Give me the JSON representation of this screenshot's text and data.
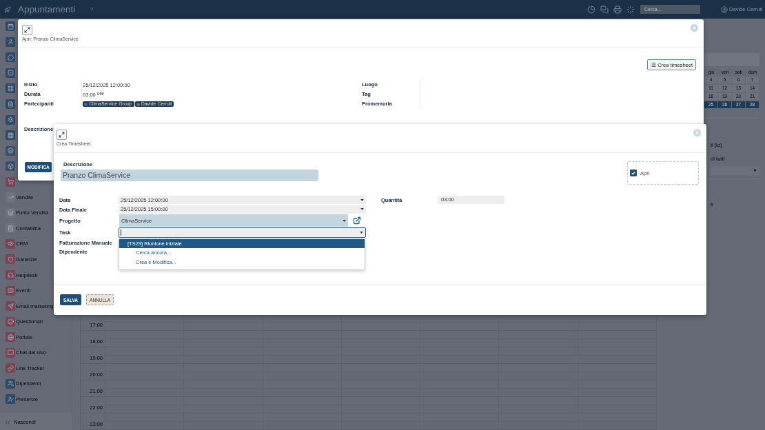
{
  "navbar": {
    "title": "Appuntamenti",
    "help": "?",
    "search": {
      "placeholder": "Cerca..."
    },
    "user": "Davide Cerruti"
  },
  "sidebar": {
    "items": [
      {
        "color": "#2e4a67"
      },
      {
        "color": "#2e4a67"
      },
      {
        "color": "#2e4a67"
      },
      {
        "color": "#2e4a67"
      },
      {
        "color": "#2e4a67"
      },
      {
        "color": "#2e4a67"
      },
      {
        "color": "#2e4a67"
      },
      {
        "color": "#2e4a67"
      },
      {
        "color": "#3a5068"
      },
      {
        "color": "#3a5068"
      },
      {
        "color": "#7a4552"
      },
      {
        "label": "Vendite",
        "color": "#6e727c"
      },
      {
        "label": "Punto Vendita",
        "color": "#6e727c"
      },
      {
        "label": "Contabilità",
        "color": "#6e727c"
      },
      {
        "label": "CRM",
        "color": "#7a4552"
      },
      {
        "label": "Garanzie",
        "color": "#7a4552"
      },
      {
        "label": "Helpdesk",
        "color": "#7a4552"
      },
      {
        "label": "Eventi",
        "color": "#7a4552"
      },
      {
        "label": "Email marketing",
        "color": "#7a4552"
      },
      {
        "label": "Questionari",
        "color": "#7a4552"
      },
      {
        "label": "Portale",
        "color": "#7a4552"
      },
      {
        "label": "Chat dal vivo",
        "color": "#7a4552"
      },
      {
        "label": "Link Tracker",
        "color": "#7a4552"
      },
      {
        "label": "Dipendenti",
        "color": "#2e4a67"
      },
      {
        "label": "Presenze",
        "color": "#2e4a67"
      }
    ],
    "collapse_label": "Nascondi"
  },
  "calendar": {
    "hours": [
      "17:00",
      "18:00",
      "19:00",
      "20:00",
      "21:00",
      "22:00",
      "23:00"
    ]
  },
  "side_panel": {
    "weekdays": [
      "gio",
      "ven",
      "sab",
      "dom"
    ],
    "weeks": [
      {
        "days": [
          {
            "day": "4",
            "selected": false
          },
          {
            "day": "5",
            "selected": false
          },
          {
            "day": "6",
            "selected": false
          },
          {
            "day": "7",
            "selected": false
          }
        ]
      },
      {
        "days": [
          {
            "day": "11",
            "selected": false
          },
          {
            "day": "12",
            "selected": false
          },
          {
            "day": "13",
            "selected": false
          },
          {
            "day": "14",
            "selected": false
          }
        ]
      },
      {
        "days": [
          {
            "day": "18",
            "selected": false
          },
          {
            "day": "19",
            "selected": false
          },
          {
            "day": "20",
            "selected": false
          },
          {
            "day": "21",
            "selected": false
          }
        ]
      },
      {
        "days": [
          {
            "day": "25",
            "selected": true
          },
          {
            "day": "26",
            "selected": true
          },
          {
            "day": "27",
            "selected": true
          },
          {
            "day": "28",
            "selected": true
          }
        ]
      }
    ],
    "filter_texts": [
      "ti [io]",
      "di tutti",
      "ti"
    ]
  },
  "event_dialog": {
    "title": "Apri: Pranzo ClimaService",
    "timesheet_button": "Crea timesheet",
    "details": [
      {
        "label": "Inizio",
        "value": "25/12/2025 12:00:00"
      },
      {
        "label": "Durata",
        "value": "03:00",
        "unit": "ore"
      },
      {
        "label": "Partecipanti",
        "tags": [
          {
            "text": "ClimaService Group",
            "color": "#2f6ea8"
          },
          {
            "text": "Davide Cerruti",
            "color": "#6a6f76"
          }
        ]
      }
    ],
    "extra_labels": [
      "Luogo",
      "Tag",
      "Promemoria"
    ],
    "description_label": "Descrizione",
    "edit_button": "MODIFICA"
  },
  "timesheet_dialog": {
    "title": "Crea Timesheet",
    "description": {
      "label": "Descrizione",
      "value": "Pranzo ClimaService"
    },
    "open_checkbox": {
      "label": "Apri",
      "checked": true
    },
    "fields": [
      {
        "label": "Data",
        "kind": "date",
        "value": "25/12/2025 12:00:00"
      },
      {
        "label": "Data Finale",
        "kind": "date",
        "value": "25/12/2025 15:00:00"
      },
      {
        "label": "Progetto",
        "kind": "project",
        "value": "ClimaService"
      },
      {
        "label": "Task",
        "kind": "search",
        "focused": true
      },
      {
        "label": "Fatturazione Manuale"
      },
      {
        "label": "Dipendente"
      }
    ],
    "quantity": {
      "label": "Quantità",
      "value": "03:00"
    },
    "task_menu": [
      {
        "text": "[TS23] Riunione iniziale",
        "kind": "option",
        "selected": true
      },
      {
        "text": "Cerca ancora...",
        "kind": "action",
        "selected": false
      },
      {
        "text": "Crea e Modifica...",
        "kind": "action",
        "selected": false
      }
    ],
    "buttons": [
      {
        "text": "SALVA",
        "kind": "primary"
      },
      {
        "text": "ANNULLA",
        "kind": "secondary"
      }
    ]
  }
}
